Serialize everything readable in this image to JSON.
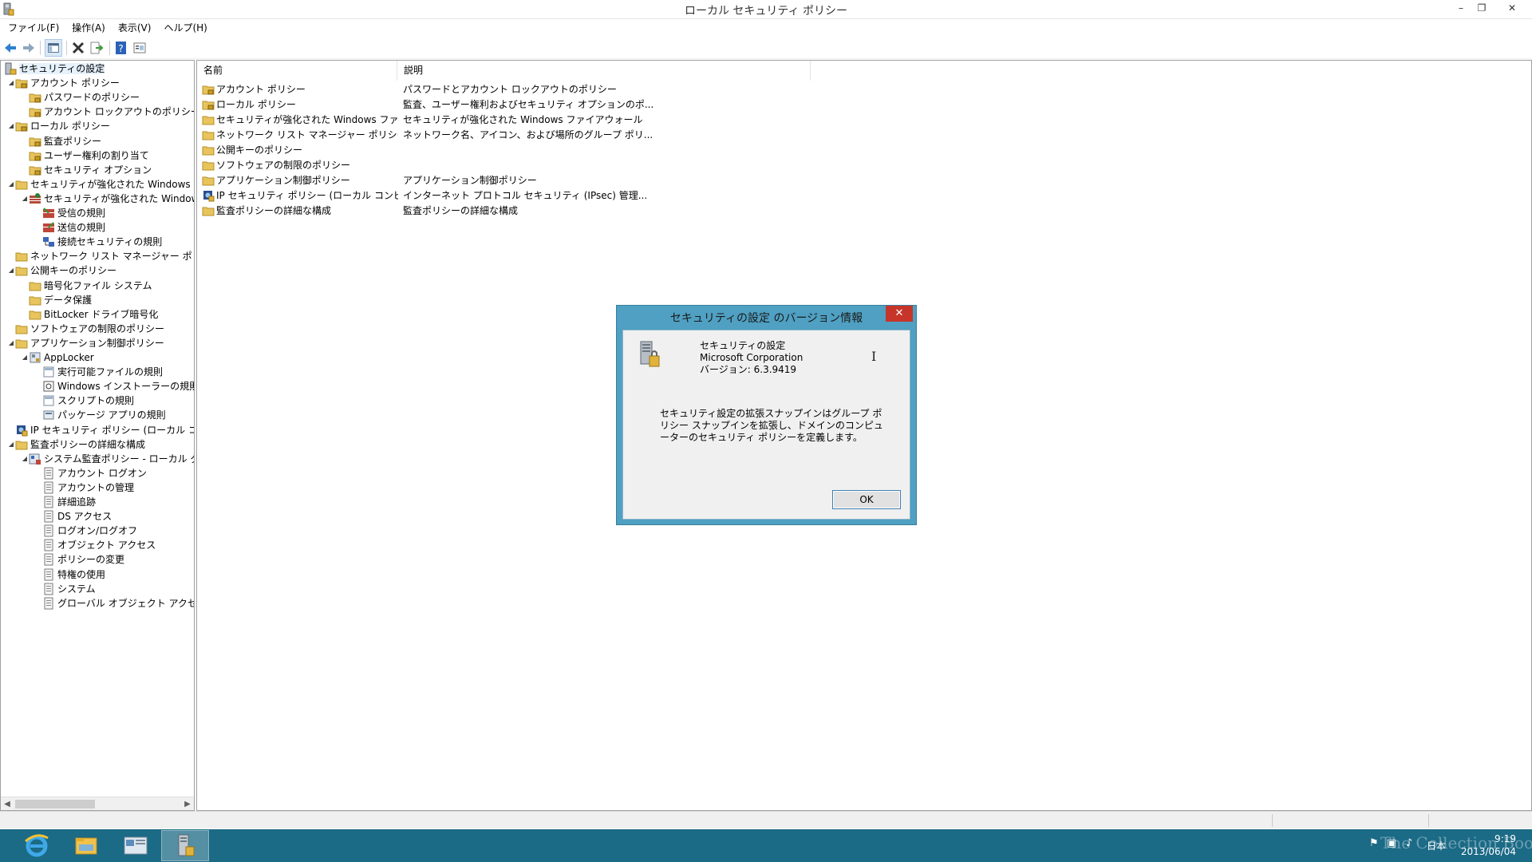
{
  "window": {
    "title": "ローカル セキュリティ ポリシー",
    "controls": [
      "–",
      "❐",
      "✕"
    ]
  },
  "menu": [
    "ファイル(F)",
    "操作(A)",
    "表示(V)",
    "ヘルプ(H)"
  ],
  "toolbar": {
    "icons": [
      "back-arrow-icon",
      "forward-arrow-icon",
      "show-hide-console-tree-icon",
      "delete-icon",
      "export-list-icon",
      "help-icon",
      "properties-icon"
    ]
  },
  "tree": [
    {
      "label": "セキュリティの設定",
      "level": 0,
      "arrow": "",
      "icon": "security-settings-icon",
      "selected": true
    },
    {
      "label": "アカウント ポリシー",
      "level": 1,
      "arrow": "◢",
      "icon": "folder-lock-icon"
    },
    {
      "label": "パスワードのポリシー",
      "level": 2,
      "arrow": "",
      "icon": "folder-lock-icon"
    },
    {
      "label": "アカウント ロックアウトのポリシー",
      "level": 2,
      "arrow": "",
      "icon": "folder-lock-icon"
    },
    {
      "label": "ローカル ポリシー",
      "level": 1,
      "arrow": "◢",
      "icon": "folder-lock-icon"
    },
    {
      "label": "監査ポリシー",
      "level": 2,
      "arrow": "",
      "icon": "folder-lock-icon"
    },
    {
      "label": "ユーザー権利の割り当て",
      "level": 2,
      "arrow": "",
      "icon": "folder-lock-icon"
    },
    {
      "label": "セキュリティ オプション",
      "level": 2,
      "arrow": "",
      "icon": "folder-lock-icon"
    },
    {
      "label": "セキュリティが強化された Windows ファイ",
      "level": 1,
      "arrow": "◢",
      "icon": "folder-icon"
    },
    {
      "label": "セキュリティが強化された Windows フ",
      "level": 2,
      "arrow": "◢",
      "icon": "firewall-icon"
    },
    {
      "label": "受信の規則",
      "level": 3,
      "arrow": "",
      "icon": "inbound-rules-icon"
    },
    {
      "label": "送信の規則",
      "level": 3,
      "arrow": "",
      "icon": "outbound-rules-icon"
    },
    {
      "label": "接続セキュリティの規則",
      "level": 3,
      "arrow": "",
      "icon": "connection-security-icon"
    },
    {
      "label": "ネットワーク リスト マネージャー ポリシー",
      "level": 1,
      "arrow": "",
      "icon": "folder-icon"
    },
    {
      "label": "公開キーのポリシー",
      "level": 1,
      "arrow": "◢",
      "icon": "folder-icon"
    },
    {
      "label": "暗号化ファイル システム",
      "level": 2,
      "arrow": "",
      "icon": "folder-icon"
    },
    {
      "label": "データ保護",
      "level": 2,
      "arrow": "",
      "icon": "folder-icon"
    },
    {
      "label": "BitLocker ドライブ暗号化",
      "level": 2,
      "arrow": "",
      "icon": "folder-icon"
    },
    {
      "label": "ソフトウェアの制限のポリシー",
      "level": 1,
      "arrow": "",
      "icon": "folder-icon"
    },
    {
      "label": "アプリケーション制御ポリシー",
      "level": 1,
      "arrow": "◢",
      "icon": "folder-icon"
    },
    {
      "label": "AppLocker",
      "level": 2,
      "arrow": "◢",
      "icon": "applocker-icon"
    },
    {
      "label": "実行可能ファイルの規則",
      "level": 3,
      "arrow": "",
      "icon": "rule-doc-icon"
    },
    {
      "label": "Windows インストーラーの規則",
      "level": 3,
      "arrow": "",
      "icon": "installer-rule-icon"
    },
    {
      "label": "スクリプトの規則",
      "level": 3,
      "arrow": "",
      "icon": "rule-doc-icon"
    },
    {
      "label": "パッケージ アプリの規則",
      "level": 3,
      "arrow": "",
      "icon": "package-rule-icon"
    },
    {
      "label": "IP セキュリティ ポリシー (ローカル コンピュー",
      "level": 1,
      "arrow": "",
      "icon": "ip-security-icon"
    },
    {
      "label": "監査ポリシーの詳細な構成",
      "level": 1,
      "arrow": "◢",
      "icon": "folder-icon"
    },
    {
      "label": "システム監査ポリシー - ローカル グルー",
      "level": 2,
      "arrow": "◢",
      "icon": "audit-policy-icon"
    },
    {
      "label": "アカウント ログオン",
      "level": 3,
      "arrow": "",
      "icon": "audit-doc-icon"
    },
    {
      "label": "アカウントの管理",
      "level": 3,
      "arrow": "",
      "icon": "audit-doc-icon"
    },
    {
      "label": "詳細追跡",
      "level": 3,
      "arrow": "",
      "icon": "audit-doc-icon"
    },
    {
      "label": "DS アクセス",
      "level": 3,
      "arrow": "",
      "icon": "audit-doc-icon"
    },
    {
      "label": "ログオン/ログオフ",
      "level": 3,
      "arrow": "",
      "icon": "audit-doc-icon"
    },
    {
      "label": "オブジェクト アクセス",
      "level": 3,
      "arrow": "",
      "icon": "audit-doc-icon"
    },
    {
      "label": "ポリシーの変更",
      "level": 3,
      "arrow": "",
      "icon": "audit-doc-icon"
    },
    {
      "label": "特権の使用",
      "level": 3,
      "arrow": "",
      "icon": "audit-doc-icon"
    },
    {
      "label": "システム",
      "level": 3,
      "arrow": "",
      "icon": "audit-doc-icon"
    },
    {
      "label": "グローバル オブジェクト アクセスの監",
      "level": 3,
      "arrow": "",
      "icon": "audit-doc-icon"
    }
  ],
  "list": {
    "columns": [
      "名前",
      "説明"
    ],
    "rows": [
      {
        "name": "アカウント ポリシー",
        "desc": "パスワードとアカウント ロックアウトのポリシー",
        "icon": "folder-lock-icon"
      },
      {
        "name": "ローカル ポリシー",
        "desc": "監査、ユーザー権利およびセキュリティ オプションのポ...",
        "icon": "folder-lock-icon"
      },
      {
        "name": "セキュリティが強化された Windows ファイア...",
        "desc": "セキュリティが強化された Windows ファイアウォール",
        "icon": "folder-icon"
      },
      {
        "name": "ネットワーク リスト マネージャー ポリシー",
        "desc": "ネットワーク名、アイコン、および場所のグループ ポリ...",
        "icon": "folder-icon"
      },
      {
        "name": "公開キーのポリシー",
        "desc": "",
        "icon": "folder-icon"
      },
      {
        "name": "ソフトウェアの制限のポリシー",
        "desc": "",
        "icon": "folder-icon"
      },
      {
        "name": "アプリケーション制御ポリシー",
        "desc": "アプリケーション制御ポリシー",
        "icon": "folder-icon"
      },
      {
        "name": "IP セキュリティ ポリシー (ローカル コンピューター)",
        "desc": "インターネット プロトコル セキュリティ (IPsec) 管理...",
        "icon": "ip-security-icon"
      },
      {
        "name": "監査ポリシーの詳細な構成",
        "desc": "監査ポリシーの詳細な構成",
        "icon": "folder-icon"
      }
    ]
  },
  "dialog": {
    "title": "セキュリティの設定 のバージョン情報",
    "close": "✕",
    "product": "セキュリティの設定",
    "company": "Microsoft Corporation",
    "version": "バージョン: 6.3.9419",
    "description": "セキュリティ設定の拡張スナップインはグループ ポリシー スナップインを拡張し、ドメインのコンピューターのセキュリティ ポリシーを定義します。",
    "ok": "OK"
  },
  "taskbar": {
    "apps": [
      "internet-explorer-icon",
      "file-explorer-icon",
      "server-manager-icon",
      "local-security-policy-icon"
    ],
    "watermark": "The Collection Book",
    "tray_lang": "日本",
    "time": "9:19",
    "date": "2013/06/04"
  },
  "colors": {
    "taskbar": "#1b6a86",
    "dialog_frame": "#4fa0c2",
    "close_red": "#c7352a",
    "folder": "#e8c45c"
  }
}
